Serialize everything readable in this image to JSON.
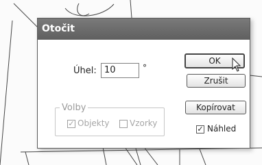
{
  "dialog": {
    "title": "Otočit",
    "angle_label": "Úhel:",
    "angle_value": "10",
    "angle_unit": "°",
    "buttons": {
      "ok": "OK",
      "cancel": "Zrušit",
      "copy": "Kopírovat"
    },
    "options": {
      "legend": "Volby",
      "objects_label": "Objekty",
      "objects_checked": true,
      "patterns_label": "Vzorky",
      "patterns_checked": false
    },
    "preview_label": "Náhled",
    "preview_checked": true
  }
}
